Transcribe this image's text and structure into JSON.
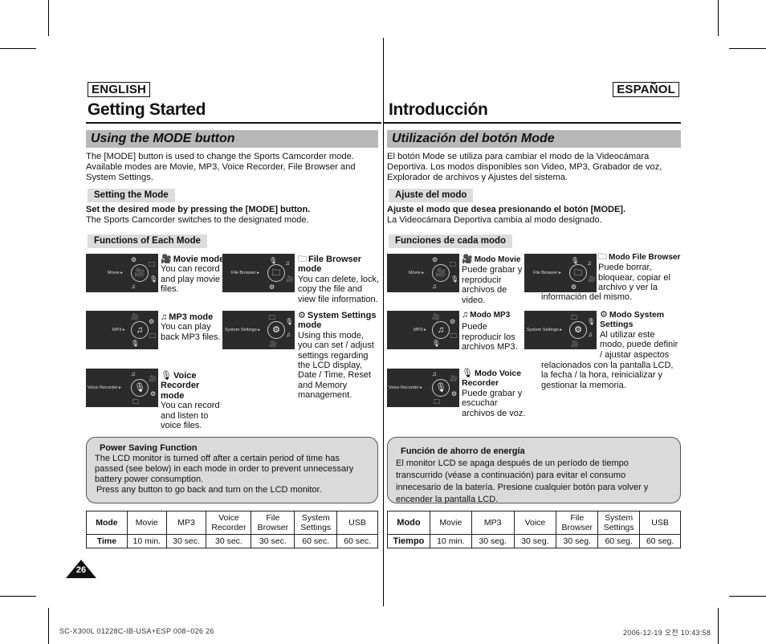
{
  "english": {
    "lang_badge": "ENGLISH",
    "page_title": "Getting Started",
    "section_title": "Using the MODE button",
    "intro": "The [MODE] button is used to change the Sports Camcorder mode. Available modes are Movie, MP3, Voice Recorder, File Browser and System Settings.",
    "setting_label": "Setting the Mode",
    "setting_bold": "Set the desired mode by pressing the [MODE] button.",
    "setting_text": "The Sports Camcorder switches to the designated mode.",
    "functions_label": "Functions of Each Mode",
    "modes": {
      "movie": {
        "screen_label": "Movie ▸",
        "title": "Movie mode",
        "desc": "You can record and play movie files."
      },
      "file_browser": {
        "screen_label": "File Browser ▸",
        "title": "File Browser mode",
        "desc": "You can delete, lock, copy the file and view file information."
      },
      "mp3": {
        "screen_label": "MP3 ▸",
        "title": "MP3 mode",
        "desc": "You can play back MP3 files."
      },
      "system_settings": {
        "screen_label": "System Settings ▸",
        "title": "System Settings mode",
        "desc": "Using this mode, you can set / adjust settings regarding the LCD display, Date / Time, Reset and Memory management."
      },
      "voice_recorder": {
        "screen_label": "Voice Recorder ▸",
        "title": "Voice Recorder mode",
        "desc": "You can record and listen to voice files."
      }
    },
    "power_saving": {
      "title": "Power Saving Function",
      "text": "The LCD monitor is turned off after a certain period of time has passed (see below) in each mode in order to prevent unnecessary battery power consumption.",
      "text2": "Press any button to go back and turn on the LCD monitor."
    },
    "table": {
      "row1": [
        "Mode",
        "Movie",
        "MP3",
        "Voice Recorder",
        "File Browser",
        "System Settings",
        "USB"
      ],
      "row2": [
        "Time",
        "10 min.",
        "30 sec.",
        "30 sec.",
        "30 sec.",
        "60 sec.",
        "60 sec."
      ]
    }
  },
  "spanish": {
    "lang_badge": "ESPAÑOL",
    "page_title": "Introducción",
    "section_title": "Utilización del botón Mode",
    "intro": "El botón Mode se utiliza para cambiar el modo de la Videocámara Deportiva. Los modos disponibles son Video, MP3, Grabador de voz, Explorador de archivos y Ajustes del sistema.",
    "setting_label": "Ajuste del modo",
    "setting_bold": "Ajuste el modo que desea presionando el botón [MODE].",
    "setting_text": "La Videocámara Deportiva cambia al modo designado.",
    "functions_label": "Funciones de cada modo",
    "modes": {
      "movie": {
        "screen_label": "Movie ▸",
        "title": "Modo Movie",
        "desc": "Puede grabar y reproducir archivos de video."
      },
      "file_browser": {
        "screen_label": "File Browser ▸",
        "title": "Modo File Browser",
        "desc": "Puede borrar, bloquear, copiar el archivo y ver la",
        "desc2": "información del mismo."
      },
      "mp3": {
        "screen_label": "MP3 ▸",
        "title": "Modo MP3",
        "desc": "Puede reproducir los archivos MP3."
      },
      "system_settings": {
        "screen_label": "System Settings ▸",
        "title": "Modo System Settings",
        "desc": "Al utilizar este modo, puede definir / ajustar aspectos",
        "desc2": "relacionados con la pantalla LCD, la fecha / la hora, reinicializar y gestionar la memoria."
      },
      "voice_recorder": {
        "screen_label": "Voice Recorder ▸",
        "title": "Modo Voice Recorder",
        "desc": "Puede grabar y escuchar archivos de voz."
      }
    },
    "power_saving": {
      "title": "Función de ahorro de energía",
      "text": "El monitor LCD se apaga después de un período de tiempo transcurrido (véase a continuación) para evitar el consumo innecesario de la batería. Presione cualquier botón para volver y encender la pantalla LCD."
    },
    "table": {
      "row1": [
        "Modo",
        "Movie",
        "MP3",
        "Voice",
        "File Browser",
        "System Settings",
        "USB"
      ],
      "row2": [
        "Tiempo",
        "10 min.",
        "30 seg.",
        "30 seg.",
        "30 seg.",
        "60 seg.",
        "60 seg."
      ]
    }
  },
  "icons": {
    "movie": "🎥",
    "folder": "🗀",
    "music": "♫",
    "gear": "⚙",
    "mic": "🎙"
  },
  "page_number": "26",
  "footer": {
    "left": "SC-X300L 01228C-IB-USA+ESP 008~026   26",
    "right": "2006-12-19   오전 10:43:58"
  }
}
